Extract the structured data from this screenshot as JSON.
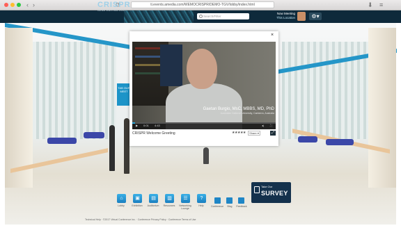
{
  "browser": {
    "url": "ti.events.amedia.com/WEMOCRISPR/DEMO-TGV/lobby/index.html",
    "nav_back": "‹",
    "nav_forward": "›",
    "reload": "⟳"
  },
  "header": {
    "logo_main": "CRISPR",
    "logo_sub": "GENE EDITING 2017",
    "search_placeholder": "Search/Filter",
    "meeting_line1": "Now Meeting",
    "meeting_line2": "This Location",
    "gear_glyph": "⚙▾"
  },
  "lobby": {
    "side_tab_text": "TAB OUR MEET"
  },
  "video_modal": {
    "close_glyph": "×",
    "speaker_name": "Gaetan Burgio, MsC, MBBS, MD, PhD",
    "speaker_role": "Australian National University, Canberra, Australia",
    "time_current": "0:01",
    "time_total": "4:43",
    "progress": 0.02,
    "title": "CRISPR Welcome Greeting",
    "rating_stars": "★★★★★",
    "share_label": "Share ▾",
    "expand_glyph": "⤢"
  },
  "toolbar": {
    "items": [
      {
        "label": "Lobby",
        "icon": "home-icon",
        "glyph": "⌂"
      },
      {
        "label": "Exhibition",
        "icon": "booth-icon",
        "glyph": "▣"
      },
      {
        "label": "Auditorium",
        "icon": "auditorium-icon",
        "glyph": "▤"
      },
      {
        "label": "Resources",
        "icon": "briefcase-icon",
        "glyph": "▥"
      },
      {
        "label": "Networking Lounge",
        "icon": "chat-icon",
        "glyph": "☰"
      },
      {
        "label": "Help",
        "icon": "help-icon",
        "glyph": "?"
      }
    ],
    "secondary": [
      {
        "label": "Conference",
        "icon": "conference-icon"
      },
      {
        "label": "Blog",
        "icon": "blog-icon"
      },
      {
        "label": "Feedback",
        "icon": "feedback-icon"
      }
    ]
  },
  "survey": {
    "take": "Take Our",
    "main": "SURVEY"
  },
  "footer": {
    "text": "Technical Help  ·  ©2017 Virtual Conference Inc.  ·  Conference Privacy Policy  ·  Conference Terms of Use"
  },
  "colors": {
    "accent": "#1d94c8",
    "header_bg": "#0e2a3b",
    "survey_bg": "#14314c"
  }
}
